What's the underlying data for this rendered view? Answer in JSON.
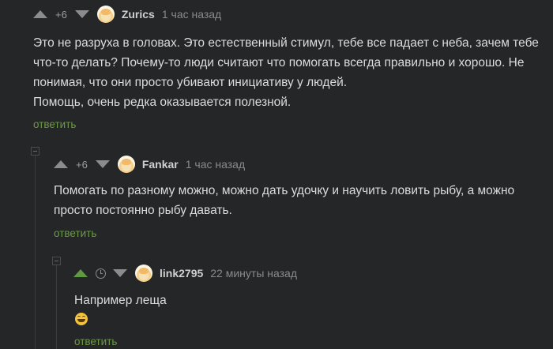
{
  "comments": [
    {
      "rating": "+6",
      "username": "Zurics",
      "time": "1 час назад",
      "lines": [
        "Это не разруха в головах. Это естественный стимул, тебе все падает с неба, зачем тебе",
        "что-то делать? Почему-то люди считают что помогать всегда правильно и хорошо. Не",
        "понимая, что они просто убивают инициативу у людей.",
        "Помощь, очень редка оказывается полезной."
      ],
      "reply_label": "ответить"
    },
    {
      "rating": "+6",
      "username": "Fankar",
      "time": "1 час назад",
      "lines": [
        "Помогать по разному можно, можно дать удочку и научить ловить рыбу, а можно",
        "просто постоянно рыбу давать."
      ],
      "reply_label": "ответить"
    },
    {
      "username": "link2795",
      "time": "22 минуты назад",
      "lines": [
        "Например леща"
      ],
      "emoji": "laughing-tears-emoji",
      "reply_label": "ответить"
    }
  ],
  "colors": {
    "background": "#252627",
    "accent_green": "#6a9a43",
    "upvote_active": "#5f9a43",
    "text": "#dcdcdc",
    "muted": "#8a8a8a"
  }
}
